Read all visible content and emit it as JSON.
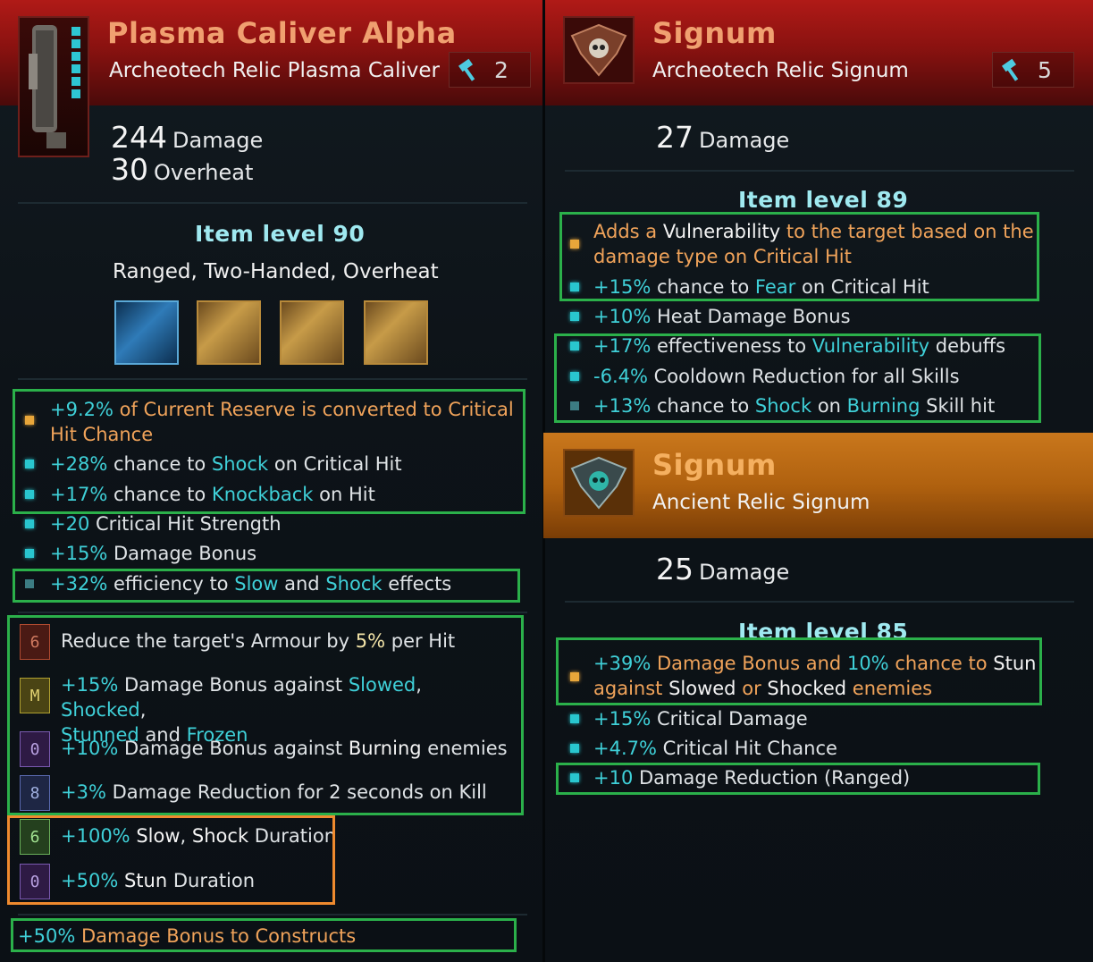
{
  "left": {
    "title": "Plasma Caliver Alpha",
    "subtitle": "Archeotech Relic Plasma Caliver",
    "tier": "2",
    "stats": [
      {
        "value": "244",
        "label": "Damage"
      },
      {
        "value": "30",
        "label": "Overheat"
      }
    ],
    "item_level": "Item level 90",
    "tags": "Ranged, Two-Handed, Overheat",
    "affixes": {
      "a1": {
        "p1": "+9.2%",
        "p2": "of Current Reserve is converted to Critical",
        "p3": "Hit Chance"
      },
      "a2": {
        "p1": "+28%",
        "p2": "chance to",
        "p3": "Shock",
        "p4": "on Critical Hit"
      },
      "a3": {
        "p1": "+17%",
        "p2": "chance to",
        "p3": "Knockback",
        "p4": "on Hit"
      },
      "a4": {
        "p1": "+20",
        "p2": "Critical Hit Strength"
      },
      "a5": {
        "p1": "+15%",
        "p2": "Damage Bonus"
      },
      "a6": {
        "p1": "+32%",
        "p2": "efficiency to",
        "p3": "Slow",
        "p4": "and",
        "p5": "Shock",
        "p6": "effects"
      }
    },
    "runes": {
      "r1": {
        "p1": "Reduce the target's Armour by",
        "p2": "5%",
        "p3": "per Hit"
      },
      "r2": {
        "p1": "+15%",
        "p2": "Damage Bonus against",
        "p3": "Slowed",
        "p4": ",",
        "p5": "Shocked",
        "p6": ",",
        "p7": "Stunned",
        "p8": "and",
        "p9": "Frozen"
      },
      "r3": {
        "p1": "+10%",
        "p2": "Damage Bonus against",
        "p3": "Burning",
        "p4": "enemies"
      },
      "r4": {
        "p1": "+3%",
        "p2": "Damage Reduction for 2 seconds on Kill"
      },
      "r5": {
        "p1": "+100%",
        "p2": "Slow",
        "p3": ",",
        "p4": "Shock",
        "p5": "Duration"
      },
      "r6": {
        "p1": "+50%",
        "p2": "Stun",
        "p3": "Duration"
      }
    },
    "footer": {
      "p1": "+50%",
      "p2": "Damage Bonus to Constructs"
    }
  },
  "right_top": {
    "title": "Signum",
    "subtitle": "Archeotech Relic Signum",
    "tier": "5",
    "stat": {
      "value": "27",
      "label": "Damage"
    },
    "item_level": "Item level 89",
    "affixes": {
      "a1": {
        "p1": "Adds a",
        "p2": "Vulnerability",
        "p3": "to the target based on the",
        "p4": "damage type on Critical Hit"
      },
      "a2": {
        "p1": "+15%",
        "p2": "chance to",
        "p3": "Fear",
        "p4": "on Critical Hit"
      },
      "a3": {
        "p1": "+10%",
        "p2": "Heat Damage Bonus"
      },
      "a4": {
        "p1": "+17%",
        "p2": "effectiveness to",
        "p3": "Vulnerability",
        "p4": "debuffs"
      },
      "a5": {
        "p1": "-6.4%",
        "p2": "Cooldown Reduction for all Skills"
      },
      "a6": {
        "p1": "+13%",
        "p2": "chance to",
        "p3": "Shock",
        "p4": "on",
        "p5": "Burning",
        "p6": "Skill hit"
      }
    }
  },
  "right_bottom": {
    "title": "Signum",
    "subtitle": "Ancient Relic Signum",
    "stat": {
      "value": "25",
      "label": "Damage"
    },
    "item_level": "Item level 85",
    "affixes": {
      "a1": {
        "p1": "+39%",
        "p2": "Damage Bonus and",
        "p3": "10%",
        "p4": "chance to",
        "p5": "Stun",
        "p6": "against",
        "p7": "Slowed",
        "p8": "or",
        "p9": "Shocked",
        "p10": "enemies"
      },
      "a2": {
        "p1": "+15%",
        "p2": "Critical Damage"
      },
      "a3": {
        "p1": "+4.7%",
        "p2": "Critical Hit Chance"
      },
      "a4": {
        "p1": "+10",
        "p2": "Damage Reduction (Ranged)"
      }
    }
  },
  "colors": {
    "title_red": "#f0a070",
    "title_orange": "#f5b060",
    "cyan": "#3fd0d8",
    "orange_text": "#f0a35a",
    "highlight_box": "#2bb04a",
    "highlight_box_alt": "#ef8a2e"
  },
  "icons": [
    "plasma-caliver-icon",
    "signum-skull-icon",
    "signum-ancient-icon",
    "hammer-icon",
    "blue-gem-icon",
    "gold-gem-icon",
    "rune-icon"
  ]
}
